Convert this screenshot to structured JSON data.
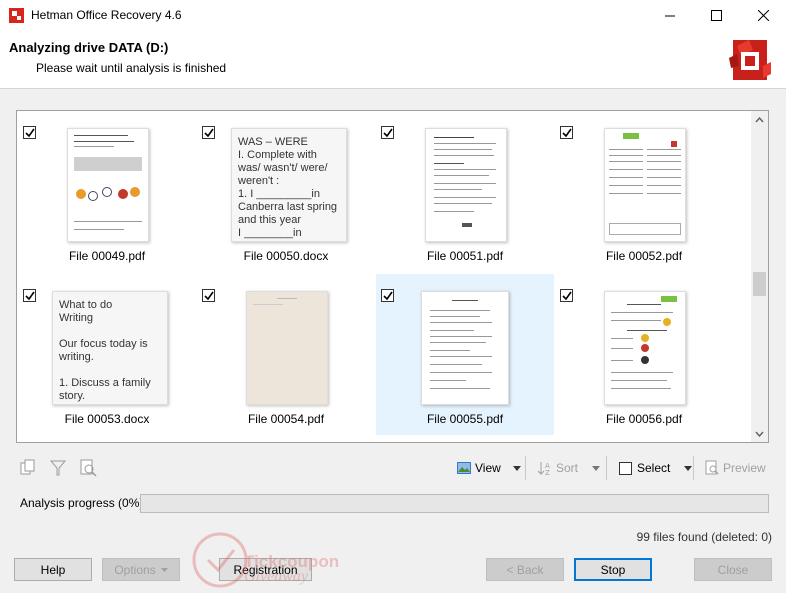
{
  "window": {
    "title": "Hetman Office Recovery 4.6"
  },
  "header": {
    "title": "Analyzing drive DATA (D:)",
    "subtitle": "Please wait until analysis is finished"
  },
  "files": [
    {
      "name": "File 00049.pdf",
      "kind": "pdf",
      "checked": true,
      "selected": false
    },
    {
      "name": "File 00050.docx",
      "kind": "doc",
      "checked": true,
      "selected": false,
      "preview": "WAS – WERE\nI. Complete with was/ wasn't/ were/ weren't :\n1. I _________in Canberra last spring and this year\nI ________in"
    },
    {
      "name": "File 00051.pdf",
      "kind": "pdf",
      "checked": true,
      "selected": false
    },
    {
      "name": "File 00052.pdf",
      "kind": "pdf",
      "checked": true,
      "selected": false
    },
    {
      "name": "File 00053.docx",
      "kind": "doc",
      "checked": true,
      "selected": false,
      "preview": "What to do\nWriting\n\nOur focus today is writing.\n\n1. Discuss a family story."
    },
    {
      "name": "File 00054.pdf",
      "kind": "pdf",
      "checked": true,
      "selected": false
    },
    {
      "name": "File 00055.pdf",
      "kind": "pdf",
      "checked": true,
      "selected": true
    },
    {
      "name": "File 00056.pdf",
      "kind": "pdf",
      "checked": true,
      "selected": false
    }
  ],
  "toolbar": {
    "view_label": "View",
    "sort_label": "Sort",
    "select_label": "Select",
    "preview_label": "Preview"
  },
  "progress": {
    "label": "Analysis progress (0%)",
    "value": 0,
    "files_found": "99 files found (deleted: 0)"
  },
  "buttons": {
    "help": "Help",
    "options": "Options",
    "registration": "Registration",
    "back": "< Back",
    "stop": "Stop",
    "close": "Close"
  },
  "watermark": {
    "line1": "Tickcoupon",
    "line2": "Giveaway"
  },
  "colors": {
    "brand_red": "#d9261c",
    "selection": "#e5f3ff",
    "focus_blue": "#0078d7"
  }
}
